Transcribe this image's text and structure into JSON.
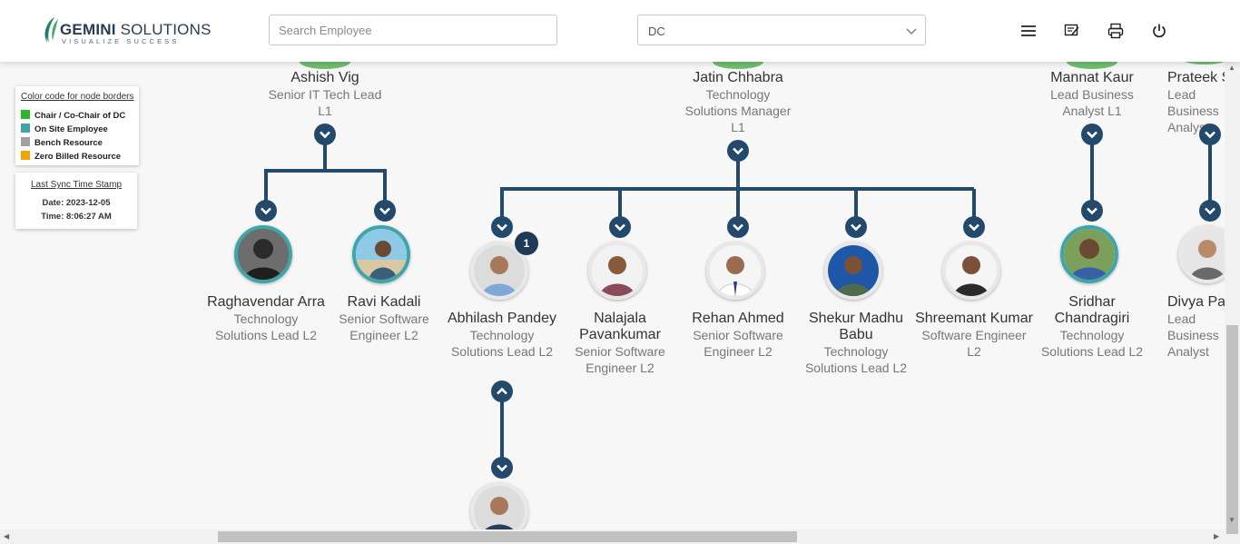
{
  "header": {
    "logo": {
      "brand_bold": "GEMINI",
      "brand_rest": " SOLUTIONS",
      "tagline": "VISUALIZE SUCCESS"
    },
    "search": {
      "placeholder": "Search Employee",
      "value": ""
    },
    "department_select": {
      "selected": "DC"
    },
    "icons": [
      "menu-icon",
      "feedback-icon",
      "print-icon",
      "power-icon"
    ]
  },
  "legend": {
    "title": "Color code for node borders",
    "items": [
      {
        "label": "Chair / Co-Chair of DC",
        "color": "#2db52d"
      },
      {
        "label": "On Site Employee",
        "color": "#3fa5a8"
      },
      {
        "label": "Bench Resource",
        "color": "#a0a0a0"
      },
      {
        "label": "Zero Billed Resource",
        "color": "#f2a500"
      }
    ]
  },
  "sync": {
    "title": "Last Sync Time Stamp",
    "date": "Date: 2023-12-05",
    "time": "Time: 8:06:27 AM"
  },
  "top_nodes": [
    {
      "name": "Ashish Vig",
      "role": "Senior IT Tech Lead L1"
    },
    {
      "name": "Jatin Chhabra",
      "role": "Technology Solutions Manager L1"
    },
    {
      "name": "Mannat Kaur",
      "role": "Lead Business Analyst L1"
    },
    {
      "name": "Prateek S",
      "role": "Lead Business Analyst"
    }
  ],
  "child_nodes": [
    {
      "name": "Raghavendar Arra",
      "role": "Technology Solutions Lead L2",
      "border": "onsite"
    },
    {
      "name": "Ravi Kadali",
      "role": "Senior Software Engineer L2",
      "border": "onsite"
    },
    {
      "name": "Abhilash Pandey",
      "role": "Technology Solutions Lead L2",
      "border": "default",
      "badge": "1"
    },
    {
      "name": "Nalajala Pavankumar",
      "role": "Senior Software Engineer L2",
      "border": "default"
    },
    {
      "name": "Rehan Ahmed",
      "role": "Senior Software Engineer L2",
      "border": "default"
    },
    {
      "name": "Shekur Madhu Babu",
      "role": "Technology Solutions Lead L2",
      "border": "default"
    },
    {
      "name": "Shreemant Kumar",
      "role": "Software Engineer L2",
      "border": "default"
    },
    {
      "name": "Sridhar Chandragiri",
      "role": "Technology Solutions Lead L2",
      "border": "onsite"
    },
    {
      "name": "Divya Pa",
      "role": "Lead Business Analyst",
      "border": "default"
    }
  ],
  "colors": {
    "connector": "#234a6b",
    "onsite_border": "#3fa5a8",
    "default_border": "#e8e8e8"
  }
}
